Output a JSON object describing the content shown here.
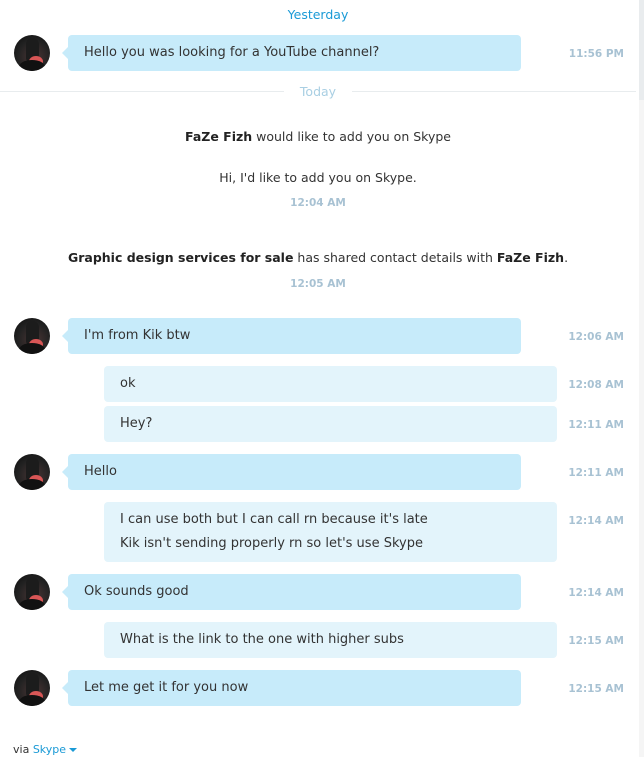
{
  "day_separators": {
    "yesterday": "Yesterday",
    "today": "Today"
  },
  "contact_request": {
    "sender": "FaZe Fizh",
    "text": "would like to add you on Skype",
    "message": "Hi, I'd like to add you on Skype.",
    "time": "12:04 AM"
  },
  "shared_contact": {
    "from": "Graphic design services for sale",
    "middle": "has shared contact details with",
    "to": "FaZe Fizh",
    "suffix": ".",
    "time": "12:05 AM"
  },
  "messages": [
    {
      "direction": "incoming",
      "lines": [
        "Hello you was looking for a YouTube channel?"
      ],
      "time": "11:56 PM"
    },
    {
      "direction": "incoming",
      "lines": [
        "I'm from Kik btw"
      ],
      "time": "12:06 AM"
    },
    {
      "direction": "outgoing",
      "lines": [
        "ok"
      ],
      "time": "12:08 AM"
    },
    {
      "direction": "outgoing",
      "lines": [
        "Hey?"
      ],
      "time": "12:11 AM"
    },
    {
      "direction": "incoming",
      "lines": [
        "Hello"
      ],
      "time": "12:11 AM"
    },
    {
      "direction": "outgoing",
      "lines": [
        "I can use both but I can call rn because it's late",
        "Kik isn't sending properly rn so let's use Skype"
      ],
      "time": "12:14 AM"
    },
    {
      "direction": "incoming",
      "lines": [
        "Ok sounds good"
      ],
      "time": "12:14 AM"
    },
    {
      "direction": "outgoing",
      "lines": [
        "What is the link to the one with higher subs"
      ],
      "time": "12:15 AM"
    },
    {
      "direction": "incoming",
      "lines": [
        "Let me get it for you now"
      ],
      "time": "12:15 AM"
    }
  ],
  "footer": {
    "via_label": "via",
    "service": "Skype"
  }
}
